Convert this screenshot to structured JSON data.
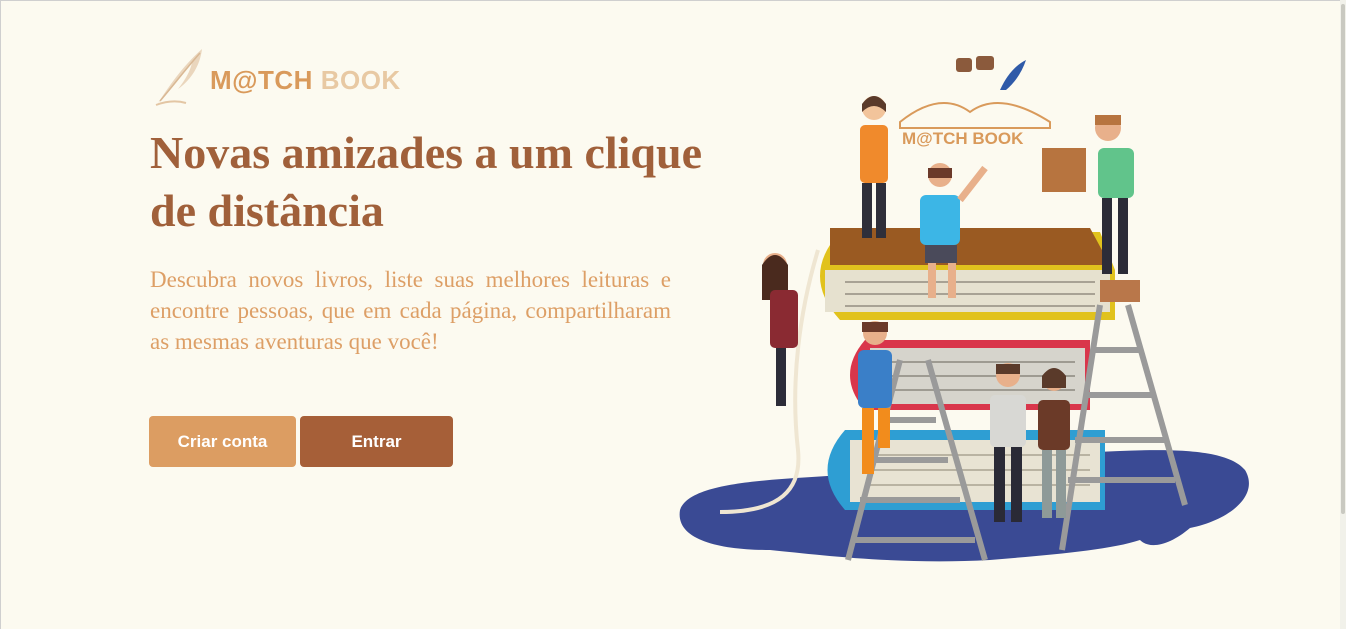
{
  "brand": {
    "logo_word_1": "M@TCH",
    "logo_word_2": "BOOK",
    "illustration_logo": "M@TCH BOOK"
  },
  "hero": {
    "headline": "Novas amizades a um clique de distância",
    "lead": "Descubra novos livros, liste suas melhores leituras e encontre pessoas, que em cada página, compartilharam as mesmas aventuras que você!"
  },
  "actions": {
    "signup_label": "Criar conta",
    "login_label": "Entrar"
  },
  "icons": {
    "logo_icon": "feather-quill-icon",
    "illustration_icons": [
      "open-book-icon",
      "chat-bubbles-icon",
      "feather-quill-icon"
    ]
  },
  "colors": {
    "background": "#fcfaf0",
    "headline": "#a0603a",
    "lead": "#dd9f66",
    "primary_button": "#dc9d62",
    "secondary_button": "#a65f38",
    "puddle": "#3a4a94"
  }
}
